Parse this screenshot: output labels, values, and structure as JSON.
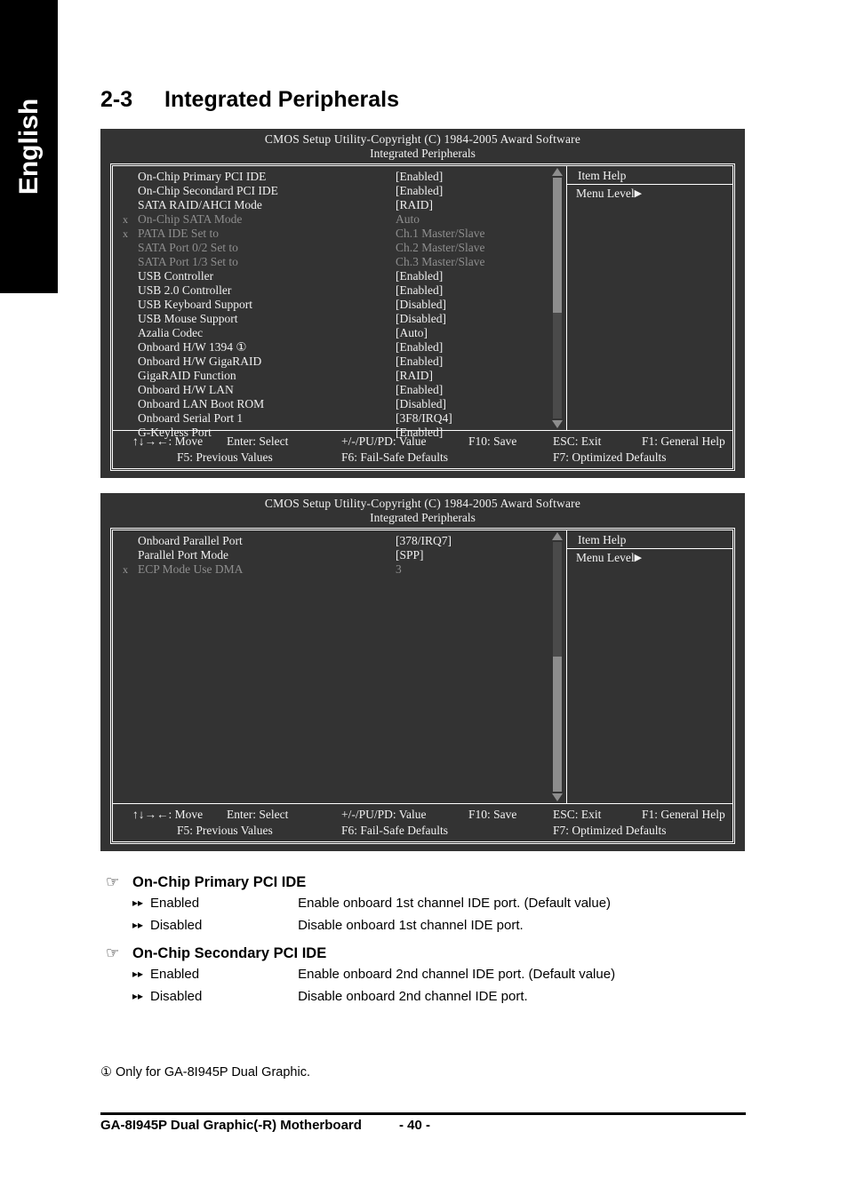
{
  "language_tab": {
    "label": "English"
  },
  "heading": {
    "number": "2-3",
    "title": "Integrated Peripherals"
  },
  "bios_screens": [
    {
      "title": "CMOS Setup Utility-Copyright (C) 1984-2005 Award Software",
      "subtitle": "Integrated Peripherals",
      "help": {
        "title": "Item Help",
        "menu_level": "Menu Level",
        "menu_level_arrow": "▶"
      },
      "scrollbar": {
        "up_arrow": "▲",
        "down_arrow": "▼",
        "thumb_top_percent": 0,
        "thumb_height_percent": 56
      },
      "rows": [
        {
          "x": "",
          "label": "On-Chip Primary PCI IDE",
          "value": "[Enabled]",
          "dim": false
        },
        {
          "x": "",
          "label": "On-Chip Secondard PCI IDE",
          "value": "[Enabled]",
          "dim": false
        },
        {
          "x": "",
          "label": "SATA RAID/AHCI Mode",
          "value": "[RAID]",
          "dim": false
        },
        {
          "x": "x",
          "label": "On-Chip SATA Mode",
          "value": "Auto",
          "dim": true
        },
        {
          "x": "x",
          "label": "PATA IDE Set to",
          "value": "Ch.1 Master/Slave",
          "dim": true
        },
        {
          "x": "",
          "label": "SATA Port 0/2 Set to",
          "value": "Ch.2 Master/Slave",
          "dim": true
        },
        {
          "x": "",
          "label": "SATA Port 1/3 Set to",
          "value": "Ch.3 Master/Slave",
          "dim": true
        },
        {
          "x": "",
          "label": "USB Controller",
          "value": "[Enabled]",
          "dim": false
        },
        {
          "x": "",
          "label": "USB 2.0 Controller",
          "value": "[Enabled]",
          "dim": false
        },
        {
          "x": "",
          "label": "USB Keyboard Support",
          "value": "[Disabled]",
          "dim": false
        },
        {
          "x": "",
          "label": "USB Mouse Support",
          "value": "[Disabled]",
          "dim": false
        },
        {
          "x": "",
          "label": "Azalia Codec",
          "value": "[Auto]",
          "dim": false
        },
        {
          "x": "",
          "label": "Onboard H/W 1394 ①",
          "value": "[Enabled]",
          "dim": false
        },
        {
          "x": "",
          "label": "Onboard H/W GigaRAID",
          "value": "[Enabled]",
          "dim": false
        },
        {
          "x": "",
          "label": "GigaRAID Function",
          "value": "[RAID]",
          "dim": false
        },
        {
          "x": "",
          "label": "Onboard H/W LAN",
          "value": "[Enabled]",
          "dim": false
        },
        {
          "x": "",
          "label": "Onboard LAN Boot ROM",
          "value": "[Disabled]",
          "dim": false
        },
        {
          "x": "",
          "label": "Onboard Serial Port 1",
          "value": "[3F8/IRQ4]",
          "dim": false
        },
        {
          "x": "",
          "label": "G-Keyless Port",
          "value": "[Enabled]",
          "dim": false
        }
      ],
      "keys": {
        "move": "↑↓→←: Move",
        "select": "Enter: Select",
        "value": "+/-/PU/PD: Value",
        "save": "F10: Save",
        "exit": "ESC: Exit",
        "general_help": "F1: General Help",
        "previous_values": "F5: Previous Values",
        "fail_safe": "F6: Fail-Safe Defaults",
        "optimized": "F7: Optimized Defaults"
      }
    },
    {
      "title": "CMOS Setup Utility-Copyright (C) 1984-2005 Award Software",
      "subtitle": "Integrated Peripherals",
      "help": {
        "title": "Item Help",
        "menu_level": "Menu Level",
        "menu_level_arrow": "▶"
      },
      "scrollbar": {
        "up_arrow": "▲",
        "down_arrow": "▼",
        "thumb_top_percent": 46,
        "thumb_height_percent": 54
      },
      "rows": [
        {
          "x": "",
          "label": "Onboard Parallel Port",
          "value": "[378/IRQ7]",
          "dim": false
        },
        {
          "x": "",
          "label": "Parallel Port Mode",
          "value": "[SPP]",
          "dim": false
        },
        {
          "x": "x",
          "label": "ECP Mode Use DMA",
          "value": "3",
          "dim": true
        }
      ],
      "keys": {
        "move": "↑↓→←: Move",
        "select": "Enter: Select",
        "value": "+/-/PU/PD: Value",
        "save": "F10: Save",
        "exit": "ESC: Exit",
        "general_help": "F1: General Help",
        "previous_values": "F5: Previous Values",
        "fail_safe": "F6: Fail-Safe Defaults",
        "optimized": "F7: Optimized Defaults"
      }
    }
  ],
  "descriptions": [
    {
      "hand_icon": "☞",
      "title": "On-Chip Primary PCI IDE",
      "options": [
        {
          "bullet": "▸▸",
          "name": "Enabled",
          "text": "Enable onboard 1st channel IDE port. (Default value)"
        },
        {
          "bullet": "▸▸",
          "name": "Disabled",
          "text": "Disable onboard 1st channel IDE port."
        }
      ]
    },
    {
      "hand_icon": "☞",
      "title": "On-Chip Secondary PCI IDE",
      "options": [
        {
          "bullet": "▸▸",
          "name": "Enabled",
          "text": "Enable onboard 2nd channel IDE port. (Default value)"
        },
        {
          "bullet": "▸▸",
          "name": "Disabled",
          "text": "Disable onboard 2nd channel IDE port."
        }
      ]
    }
  ],
  "footnote": "① Only for GA-8I945P Dual Graphic.",
  "page_footer": {
    "book_title": "GA-8I945P Dual Graphic(-R) Motherboard",
    "page_number": "- 40 -"
  }
}
